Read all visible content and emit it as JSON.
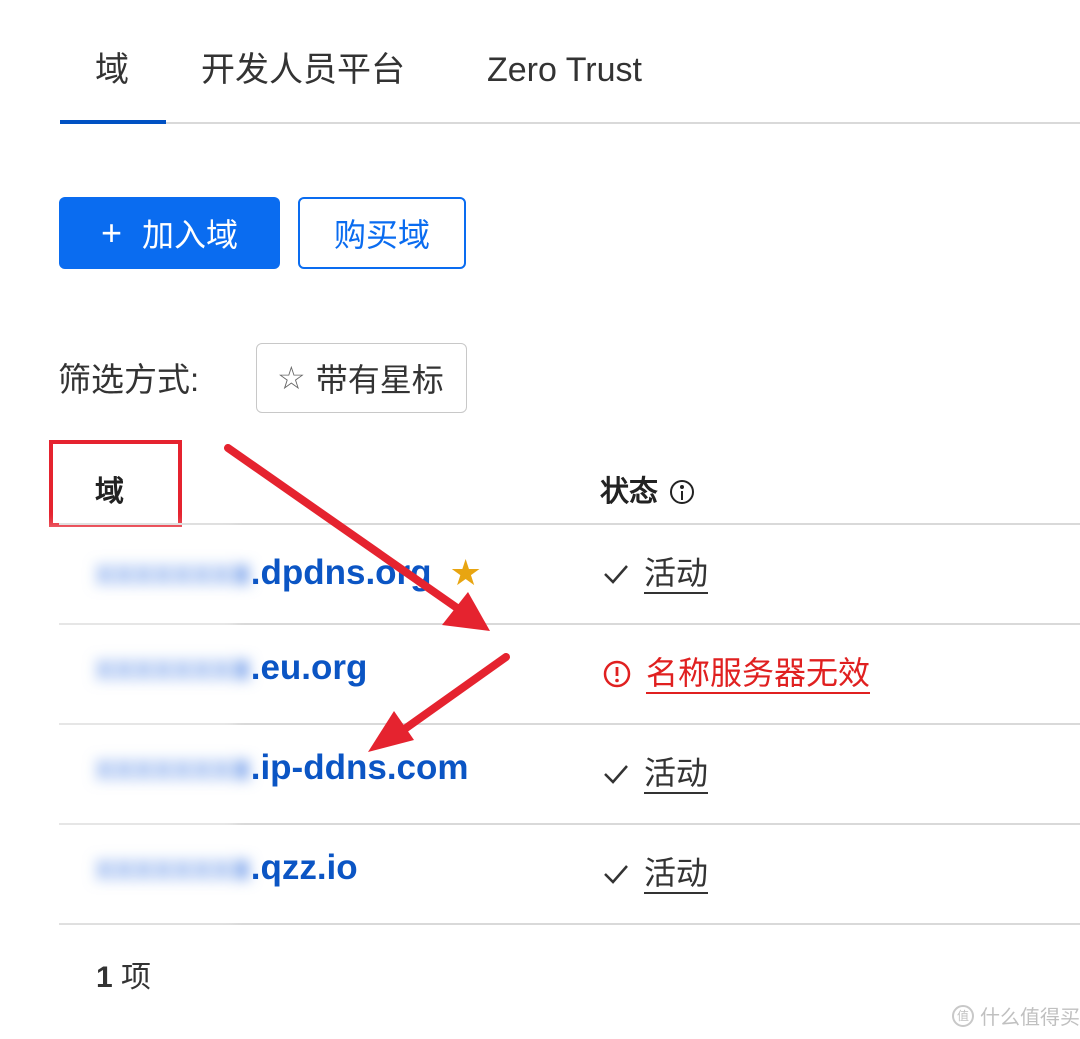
{
  "tabs": [
    {
      "label": "域",
      "active": true
    },
    {
      "label": "开发人员平台",
      "active": false
    },
    {
      "label": "Zero Trust",
      "active": false
    }
  ],
  "actions": {
    "add_domain": "加入域",
    "add_icon": "+",
    "buy_domain": "购买域"
  },
  "filter": {
    "label": "筛选方式:",
    "chip_icon": "☆",
    "chip_label": "带有星标"
  },
  "table": {
    "headers": {
      "domain": "域",
      "status": "状态"
    },
    "rows": [
      {
        "prefix": "xxxxxxxx",
        "suffix": ".dpdns.org",
        "starred": true,
        "status": "活动",
        "status_type": "active"
      },
      {
        "prefix": "xxxxxxxx",
        "suffix": ".eu.org",
        "starred": false,
        "status": "名称服务器无效",
        "status_type": "error"
      },
      {
        "prefix": "xxxxxxxx",
        "suffix": ".ip-ddns.com",
        "starred": false,
        "status": "活动",
        "status_type": "active"
      },
      {
        "prefix": "xxxxxxxx",
        "suffix": ".qzz.io",
        "starred": false,
        "status": "活动",
        "status_type": "active"
      }
    ]
  },
  "footer": {
    "count_num": "1",
    "count_unit": "项"
  },
  "watermark": {
    "logo_text": "值",
    "text": "什么值得买"
  },
  "colors": {
    "primary": "#0a6cf0",
    "link": "#0b55c4",
    "error": "#e02020",
    "annotation": "#e5232f",
    "star": "#e8a511"
  }
}
